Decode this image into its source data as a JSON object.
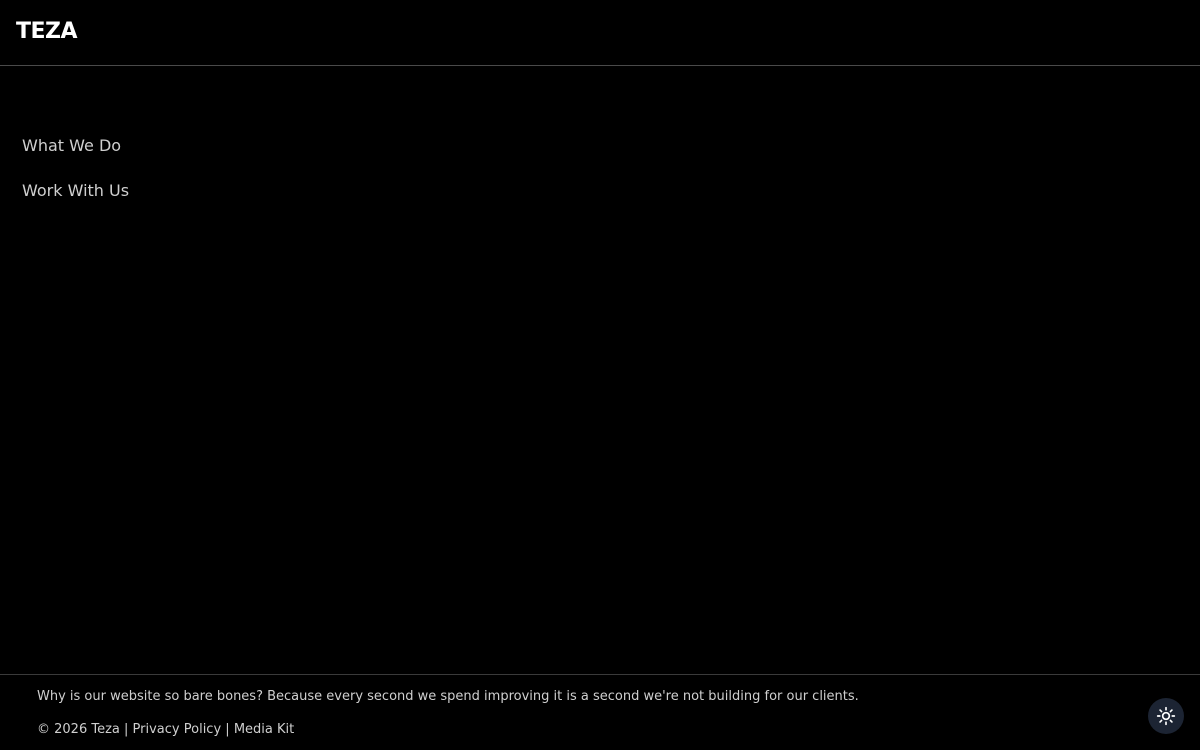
{
  "header": {
    "logo": "TEZA"
  },
  "nav": {
    "items": [
      {
        "label": "What We Do"
      },
      {
        "label": "Work With Us"
      }
    ]
  },
  "footer": {
    "note": "Why is our website so bare bones? Because every second we spend improving it is a second we're not building for our clients.",
    "copyright": "© 2026 Teza",
    "separator": "|",
    "privacy_label": "Privacy Policy",
    "media_kit_label": "Media Kit"
  },
  "theme_toggle": {
    "icon": "sun-icon"
  },
  "colors": {
    "background": "#000000",
    "text": "#cfcfcf",
    "toggle_bg": "#1c2433"
  }
}
